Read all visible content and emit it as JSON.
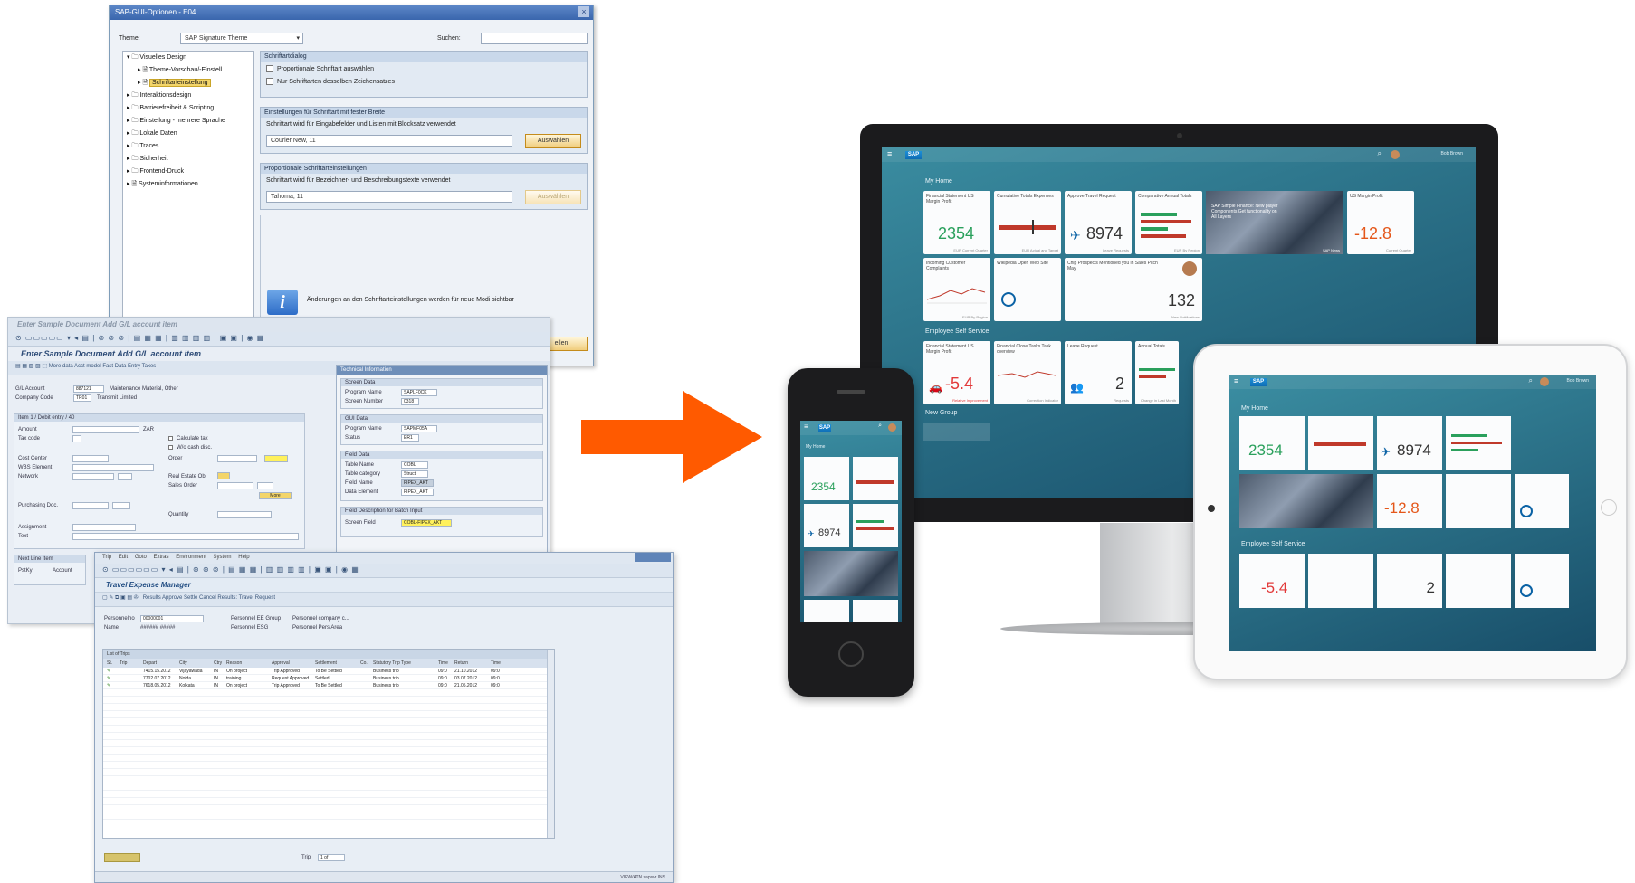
{
  "options_dialog": {
    "title": "SAP-GUI-Optionen - E04",
    "theme_label": "Theme:",
    "theme_value": "SAP Signature Theme",
    "search_label": "Suchen:",
    "tree": [
      "Visuelles Design",
      "Theme-Vorschau/-Einstell",
      "Schriftarteinstellung",
      "Interaktionsdesign",
      "Barrierefreiheit & Scripting",
      "Einstellung - mehrere Sprache",
      "Lokale Daten",
      "Traces",
      "Sicherheit",
      "Frontend-Druck",
      "Systeminformationen"
    ],
    "panel1_header": "Schriftartdialog",
    "panel1_opt1": "Proportionale Schriftart auswählen",
    "panel1_opt2": "Nur Schriftarten desselben Zeichensatzes",
    "panel2_header": "Einstellungen für Schriftart mit fester Breite",
    "panel2_text": "Schriftart wird für Eingabefelder und Listen mit Blocksatz verwendet",
    "panel2_value": "Courier New, 11",
    "panel2_button": "Auswählen",
    "panel3_header": "Proportionale Schriftarteinstellungen",
    "panel3_text": "Schriftart wird für Bezeichner- und Beschreibungstexte verwendet",
    "panel3_value": "Tahoma, 11",
    "panel3_button": "Auswählen",
    "info_text": "Änderungen an den Schriftarteinstellungen werden für neue Modi sichtbar",
    "bottom_button": "ellen"
  },
  "document": {
    "window_title": "Enter Sample Document Add G/L account item",
    "title": "Enter Sample Document Add G/L account item",
    "toolbar": "More data   Acct model   Fast Data Entry   Taxes",
    "fields": {
      "gl_account_label": "G/L Account",
      "gl_account_value": "887121",
      "gl_account_desc": "Maintenance Material, Other",
      "company_label": "Company Code",
      "company_value": "TR01",
      "company_desc": "Transmit Limited",
      "item_header": "Item 1 / Debit entry / 40",
      "amount_label": "Amount",
      "amount_currency": "ZAR",
      "tax_label": "Tax code",
      "calc_tax": "Calculate tax",
      "wh_tax": "W/o cash disc.",
      "cost_center": "Cost Center",
      "order": "Order",
      "wbs": "WBS Element",
      "network": "Network",
      "real_estate": "Real Estate Obj",
      "sales_order": "Sales Order",
      "more_button": "More",
      "purchasing": "Purchasing Doc.",
      "quantity": "Quantity",
      "assignment": "Assignment",
      "text": "Text",
      "next_item": "Next Line Item",
      "pstky": "PstKy",
      "account": "Account"
    },
    "tech": {
      "header": "Technical Information",
      "screen_data": "Screen Data",
      "program_name_label": "Program Name",
      "program_name_value": "SAPLF0CK",
      "screen_number_label": "Screen Number",
      "screen_number_value": "0318",
      "gui_data": "GUI Data",
      "gui_program_label": "Program Name",
      "gui_program_value": "SAPMF05A",
      "status_label": "Status",
      "status_value": "ER1",
      "field_data": "Field Data",
      "table_name_label": "Table Name",
      "table_name_value": "COBL",
      "table_cat_label": "Table category",
      "table_cat_value": "Struct",
      "field_name_label": "Field Name",
      "field_name_value": "FIPEX_AKT",
      "data_elem_label": "Data Element",
      "data_elem_value": "FIPEX_AKT",
      "batch_header": "Field Description for Batch Input",
      "screen_field_label": "Screen Field",
      "screen_field_value": "COBL-FIPEX_AKT"
    }
  },
  "travel": {
    "menu": [
      "Trip",
      "Edit",
      "Goto",
      "Extras",
      "Environment",
      "System",
      "Help"
    ],
    "title": "Travel Expense Manager",
    "toolbar": "Results   Approve   Settle   Cancel   Results: Travel Request",
    "personnel_label": "Personnelno",
    "personnel_value": "00000001",
    "name_label": "Name",
    "name_value": "###### #####",
    "ee_group": "Personnel EE Group",
    "ee_group_value": "Personnel company c...",
    "ee_subgroup": "Personnel ESG",
    "area": "Personnel Pers Area",
    "list_title": "List of Trips",
    "columns": [
      "St.",
      "Trip",
      "Depart",
      "City",
      "Ctry",
      "Reason",
      "Approval",
      "Settlement",
      "Co.",
      "Statutory Trip Type",
      "Time",
      "Return",
      "Time"
    ],
    "rows": [
      [
        "",
        "",
        "7415.15.2012",
        "Vijayawada",
        "IN",
        "On project",
        "Trip Approved",
        "To Be Settled",
        "",
        "Business trip",
        "09:0",
        "21.10.2012",
        "09:0"
      ],
      [
        "",
        "",
        "7702.07.2012",
        "Noida",
        "IN",
        "training",
        "Request Approved",
        "Settled",
        "",
        "Business trip",
        "09:0",
        "03.07.2012",
        "09:0"
      ],
      [
        "",
        "",
        "7618.05.2012",
        "Kolkata",
        "IN",
        "On project",
        "Trip Approved",
        "To Be Settled",
        "",
        "Business trip",
        "09:0",
        "21.05.2012",
        "09:0"
      ]
    ],
    "trip_label": "Trip",
    "page": "1 of",
    "status": "VIEW/ATN   sapsvr   INS"
  },
  "fiori_monitor": {
    "user": "Bob Brown",
    "group1": "My Home",
    "tiles": [
      {
        "title": "Financial Statement US Margin Profit",
        "value": "2354",
        "color": "#2aa05c",
        "foot": "EUR Current Quarter"
      },
      {
        "title": "Cumulative Totals Expenses",
        "value": "",
        "color": "#c0392b",
        "foot": "EUR Actual and Target"
      },
      {
        "title": "Approve Travel Request",
        "value": "8974",
        "color": "#333333",
        "foot": "Leave Requests"
      },
      {
        "title": "Comparative Annual Totals",
        "value": "",
        "color": "#2aa05c",
        "foot": "EUR By Region"
      },
      {
        "title": "SAP Simple Finance: New player Components Get functionality on All Layers",
        "value": "",
        "color": "#ffffff",
        "foot": "SAP News"
      },
      {
        "title": "US Margin Profit",
        "value": "-12.8",
        "color": "#e4571a",
        "foot": "Current Quarter"
      },
      {
        "title": "Incoming Customer Complaints",
        "value": "",
        "color": "#333333",
        "foot": "EUR By Region"
      },
      {
        "title": "Wikipedia Open Web Site",
        "value": "",
        "color": "#333333",
        "foot": ""
      },
      {
        "title": "Chip Prospects Mentioned you in Sales Pitch May",
        "value": "132",
        "color": "#333333",
        "foot": "New Notifications"
      }
    ],
    "group2": "Employee Self Service",
    "ess_tiles": [
      {
        "title": "Financial Statement US Margin Profit",
        "value": "-5.4",
        "color": "#e23a3a",
        "foot": "Relative Improvement"
      },
      {
        "title": "Financial Close Tasks Task overview",
        "value": "",
        "color": "#333333",
        "foot": "Correction Indicator"
      },
      {
        "title": "Leave Request",
        "value": "2",
        "color": "#333333",
        "foot": "Requests"
      },
      {
        "title": "Annual Totals",
        "value": "",
        "color": "#333333",
        "foot": "Change in Last Month"
      }
    ],
    "group3": "New Group"
  },
  "fiori_tablet": {
    "user": "Bob Brown",
    "group1": "My Home",
    "value1": "2354",
    "value2": "8974",
    "value3": "-12.8",
    "group2": "Employee Self Service",
    "value4": "-5.4",
    "value5": "2"
  },
  "fiori_phone": {
    "group1": "My Home",
    "value1": "2354",
    "value2": "8974"
  }
}
